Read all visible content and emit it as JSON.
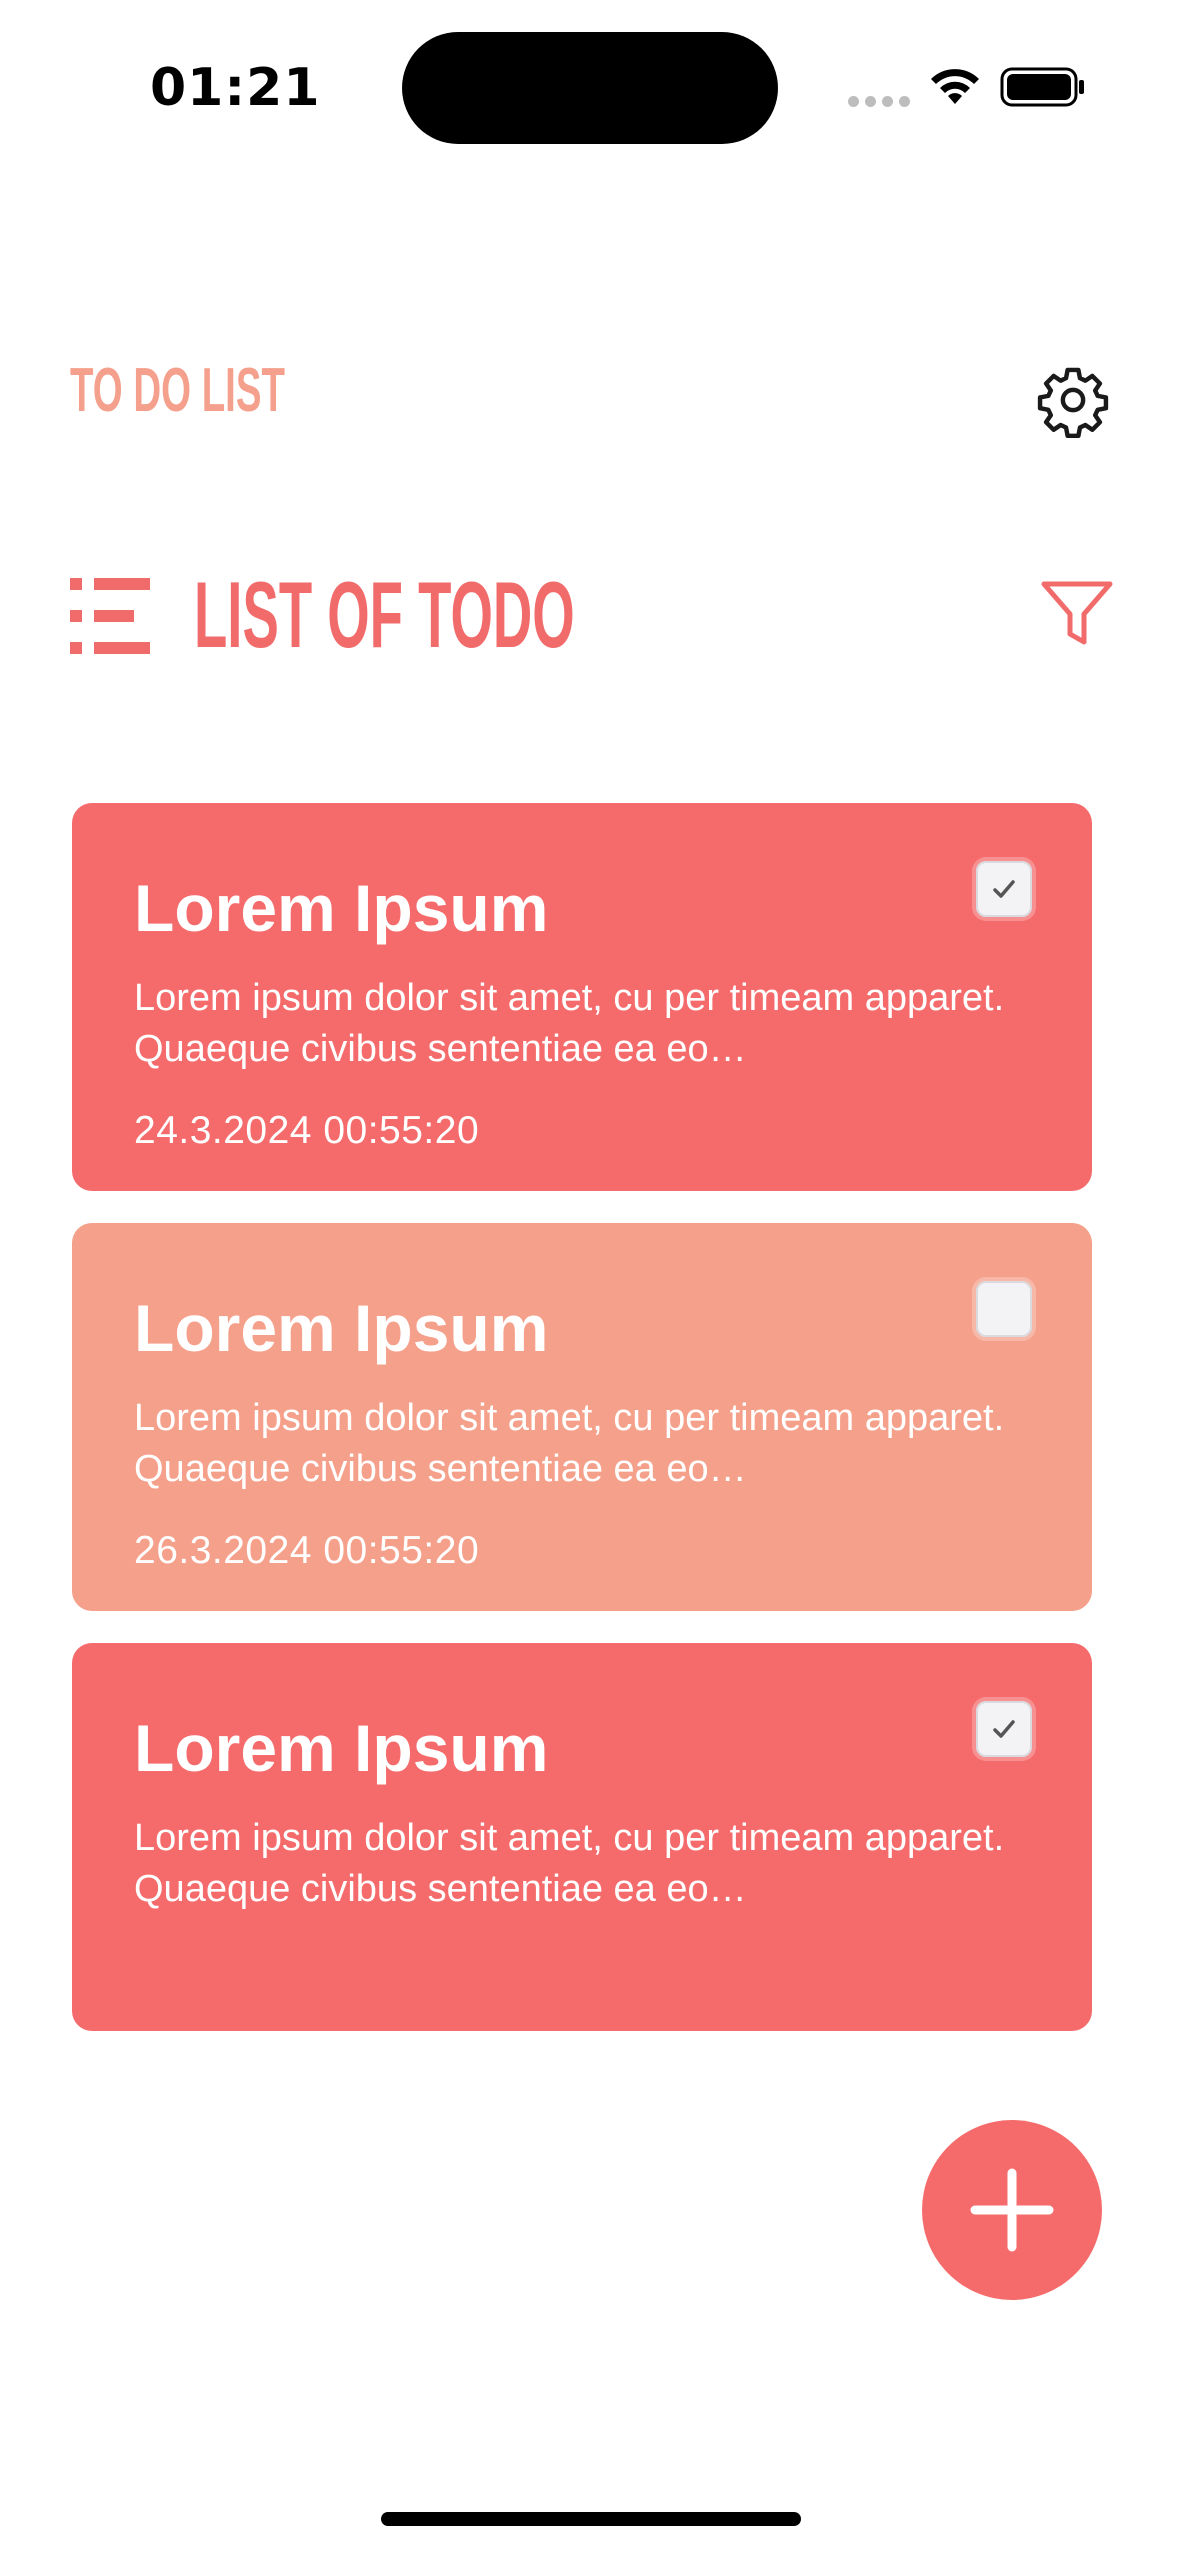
{
  "status_bar": {
    "time": "01:21"
  },
  "header": {
    "title": "TO DO LIST",
    "settings_icon": "gear-icon"
  },
  "section": {
    "title": "LIST OF TODO",
    "list_icon": "list-icon",
    "filter_icon": "filter-icon"
  },
  "todos": [
    {
      "title": "Lorem Ipsum",
      "description": "Lorem ipsum dolor sit amet, cu per timeam apparet. Quaeque civibus sententiae ea eo…",
      "date": "24.3.2024 00:55:20",
      "checked": true,
      "color": "#f56b6b"
    },
    {
      "title": "Lorem Ipsum",
      "description": "Lorem ipsum dolor sit amet, cu per timeam apparet. Quaeque civibus sententiae ea eo…",
      "date": "26.3.2024 00:55:20",
      "checked": false,
      "color": "#f5a08a"
    },
    {
      "title": "Lorem Ipsum",
      "description": "Lorem ipsum dolor sit amet, cu per timeam apparet. Quaeque civibus sententiae ea eo…",
      "date": "",
      "checked": true,
      "color": "#f56b6b"
    }
  ],
  "fab": {
    "icon": "plus-icon"
  },
  "colors": {
    "accent": "#f56b6b",
    "accent_light": "#f5a08a",
    "title_light": "#f5a08c"
  }
}
